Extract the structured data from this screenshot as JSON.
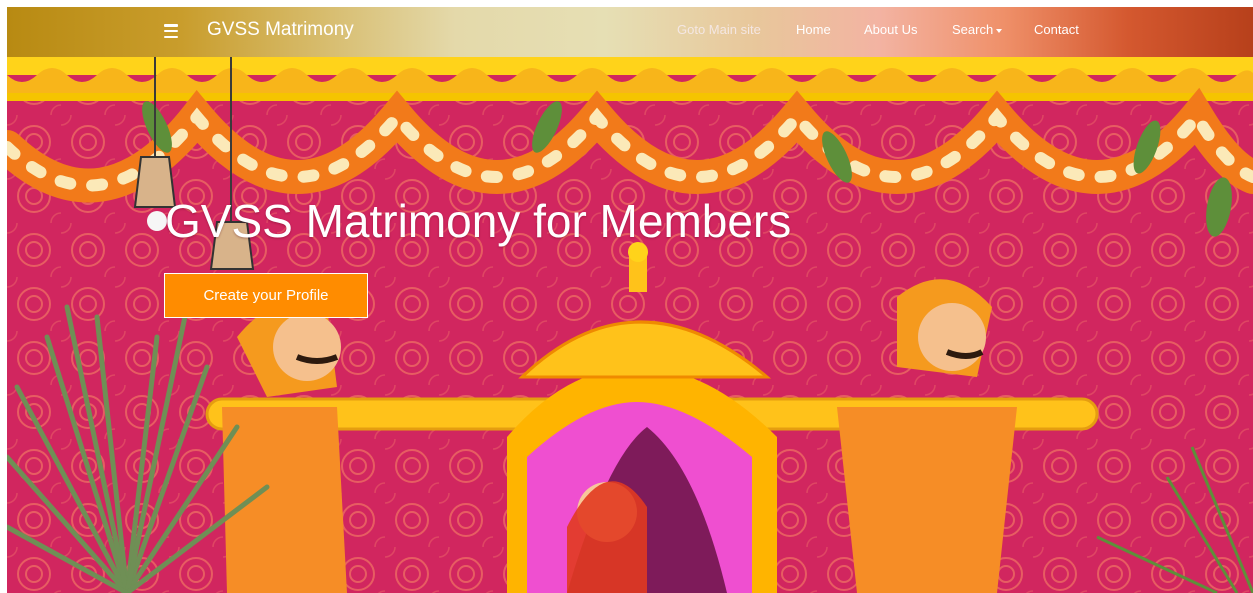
{
  "navbar": {
    "brand": "GVSS Matrimony",
    "links": [
      {
        "label": "Goto Main site"
      },
      {
        "label": "Home"
      },
      {
        "label": "About Us"
      },
      {
        "label": "Search"
      },
      {
        "label": "Contact"
      }
    ]
  },
  "hero": {
    "title": "GVSS Matrimony for Members",
    "cta_label": "Create your Profile"
  },
  "colors": {
    "hero_background": "#d1265f",
    "cta_background": "#ff8c00",
    "canopy_yellow": "#ffd31a",
    "marigold_orange": "#f27a1a"
  },
  "icons": [
    "menu-icon",
    "caret-down-icon"
  ]
}
